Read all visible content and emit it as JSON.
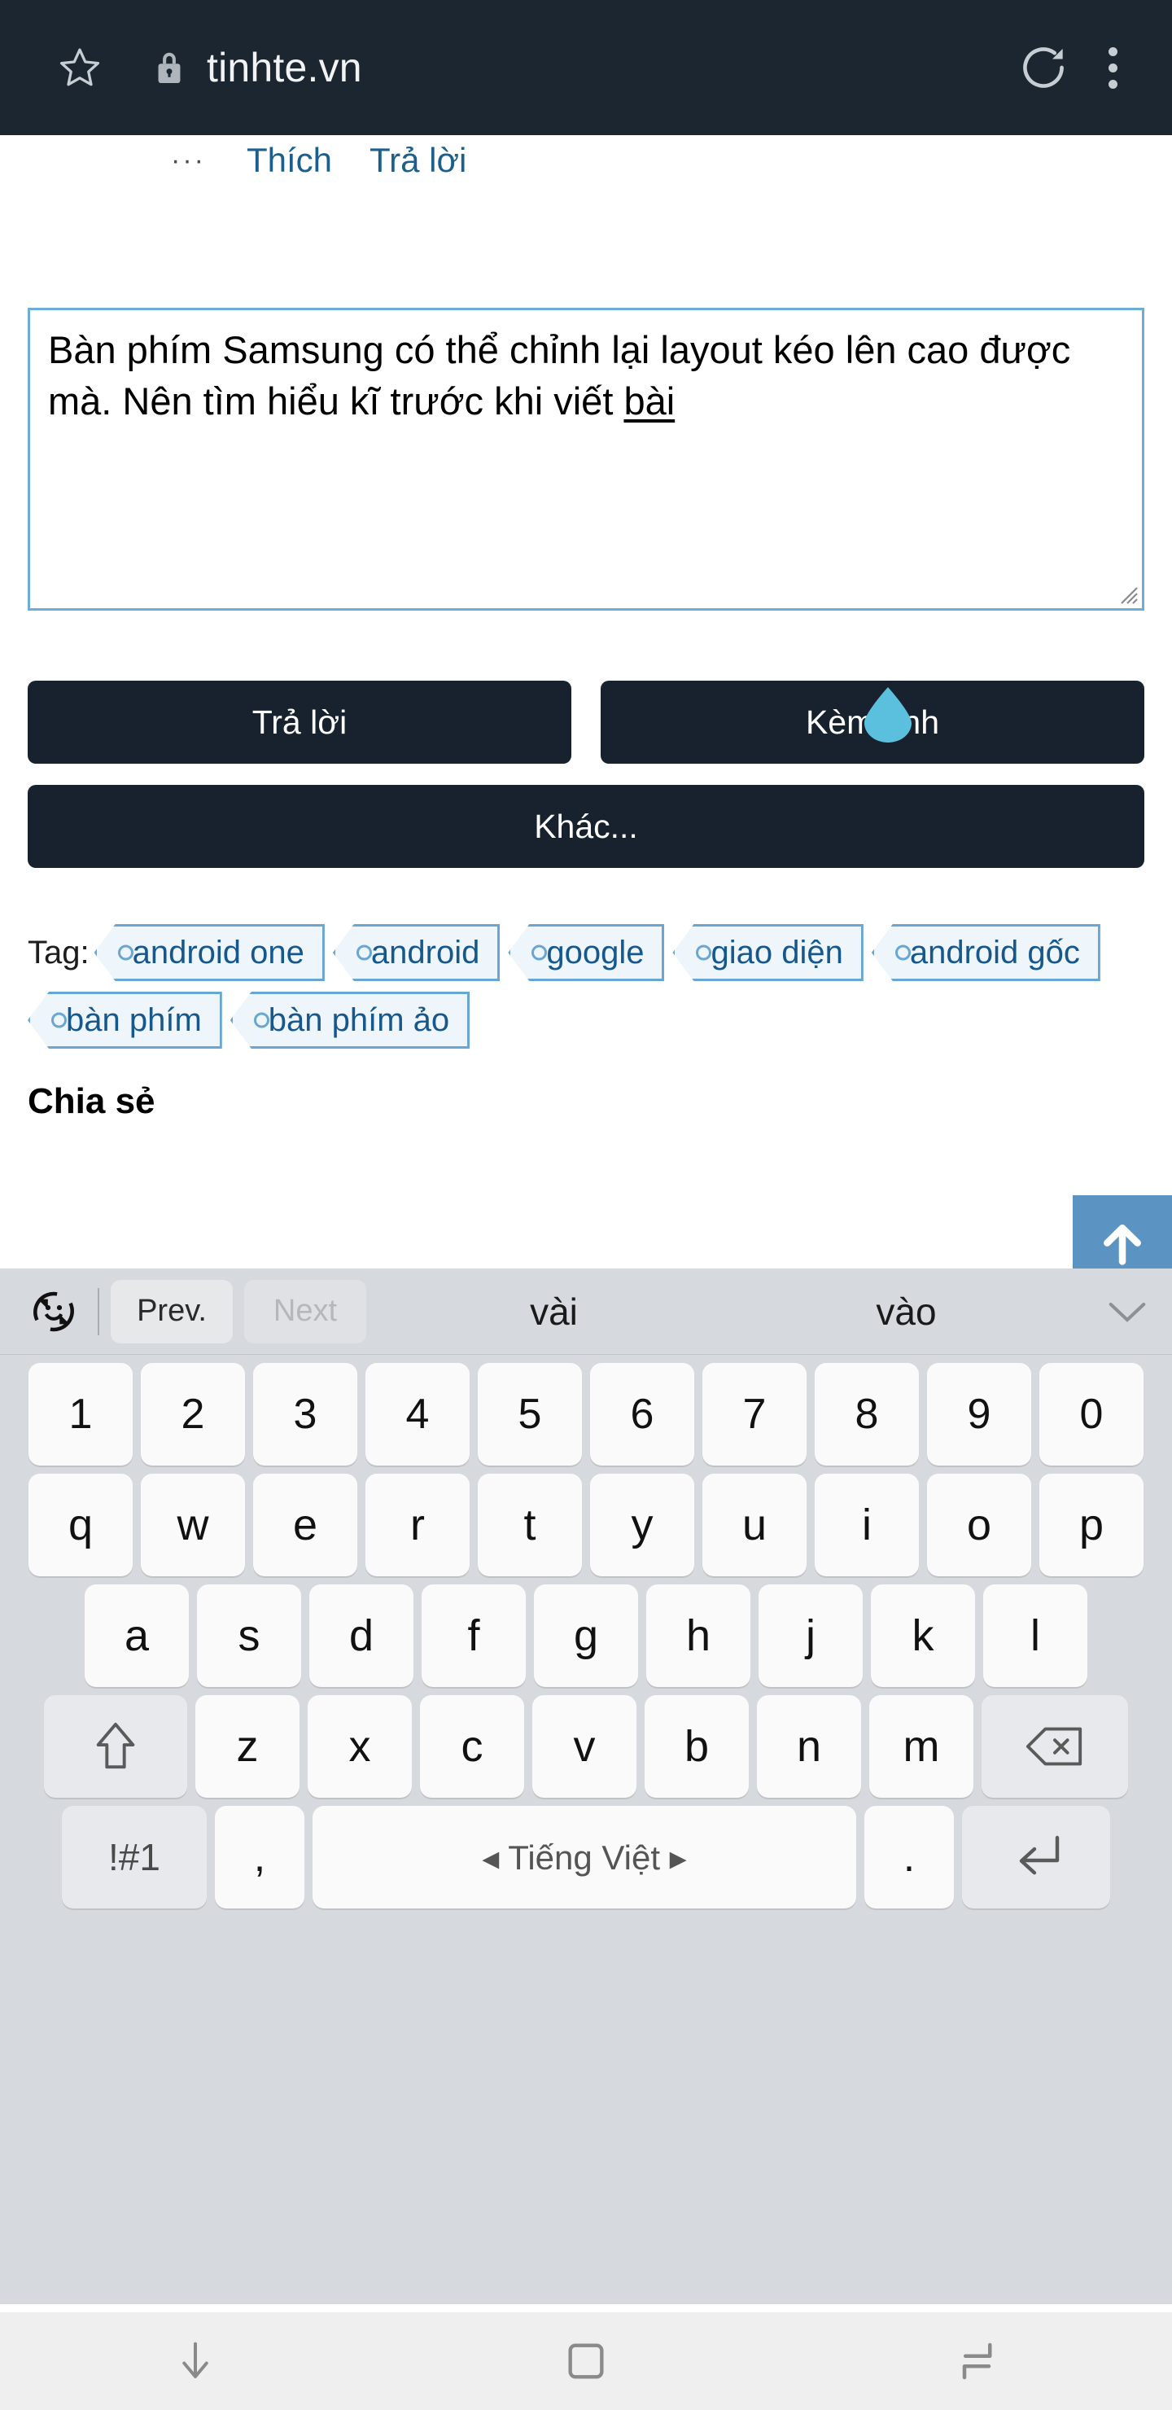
{
  "browser": {
    "url": "tinhte.vn",
    "star_icon": "star-outline-icon",
    "lock_icon": "lock-icon",
    "reload_icon": "reload-icon",
    "menu_icon": "overflow-menu-icon",
    "toolbar_bg": "#1b2631"
  },
  "post": {
    "more_dots": "···",
    "like_label": "Thích",
    "reply_label": "Trả lời"
  },
  "composer": {
    "text_part1": "Bàn phím Samsung có thể chỉnh lại layout kéo lên cao được mà. Nên tìm hiểu kĩ trước khi viết ",
    "text_underlined": "bài",
    "border_color": "#6cadda",
    "handle_color": "#5bc0de"
  },
  "buttons": {
    "reply": "Trả lời",
    "attach_image": "Kèm ảnh",
    "more": "Khác...",
    "bg": "#18222e"
  },
  "tags": {
    "label": "Tag:",
    "items": [
      "android one",
      "android",
      "google",
      "giao diện",
      "android gốc",
      "bàn phím",
      "bàn phím ảo"
    ]
  },
  "share_heading": "Chia sẻ",
  "scroll_top": {
    "icon": "arrow-up-icon",
    "bg": "#5b94c2"
  },
  "keyboard": {
    "suggestion_bar": {
      "emoji_icon": "emoji-rotate-icon",
      "prev_label": "Prev.",
      "next_label": "Next",
      "suggestions": [
        "vài",
        "vào"
      ],
      "collapse_icon": "chevron-down-icon"
    },
    "row_numbers": [
      "1",
      "2",
      "3",
      "4",
      "5",
      "6",
      "7",
      "8",
      "9",
      "0"
    ],
    "row_q": [
      "q",
      "w",
      "e",
      "r",
      "t",
      "y",
      "u",
      "i",
      "o",
      "p"
    ],
    "row_a": [
      "a",
      "s",
      "d",
      "f",
      "g",
      "h",
      "j",
      "k",
      "l"
    ],
    "row_z": [
      "z",
      "x",
      "c",
      "v",
      "b",
      "n",
      "m"
    ],
    "shift_icon": "shift-arrow-icon",
    "backspace_icon": "backspace-icon",
    "symbols_label": "!#1",
    "comma_label": ",",
    "space_label": "◂  Tiếng Việt  ▸",
    "period_label": ".",
    "enter_icon": "enter-return-icon",
    "bg": "#d6d9dd"
  },
  "navbar": {
    "back_icon": "keyboard-hide-down-arrow-icon",
    "home_icon": "home-square-icon",
    "recents_icon": "recent-apps-icon",
    "bg": "#efefef"
  }
}
